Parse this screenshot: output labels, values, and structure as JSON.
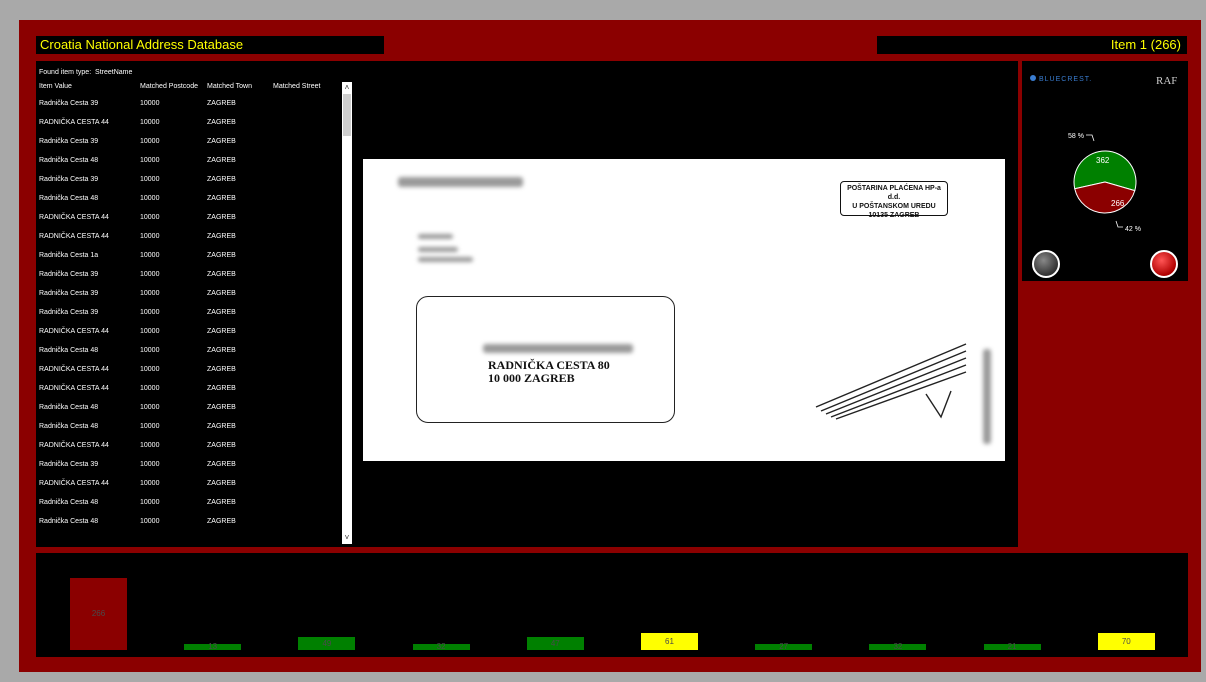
{
  "header": {
    "title": "Croatia National Address Database",
    "item_counter": "Item 1 (266)"
  },
  "list": {
    "found_label": "Found item type:",
    "found_value": "StreetName",
    "columns": [
      "Item Value",
      "Matched Postcode",
      "Matched Town",
      "Matched Street"
    ],
    "rows": [
      [
        "Radnička Cesta 39",
        "10000",
        "ZAGREB",
        ""
      ],
      [
        "RADNIČKA CESTA 44",
        "10000",
        "ZAGREB",
        ""
      ],
      [
        "Radnička Cesta 39",
        "10000",
        "ZAGREB",
        ""
      ],
      [
        "Radnička Cesta 48",
        "10000",
        "ZAGREB",
        ""
      ],
      [
        "Radnička Cesta 39",
        "10000",
        "ZAGREB",
        ""
      ],
      [
        "Radnička Cesta 48",
        "10000",
        "ZAGREB",
        ""
      ],
      [
        "RADNIČKA CESTA 44",
        "10000",
        "ZAGREB",
        ""
      ],
      [
        "RADNIČKA CESTA 44",
        "10000",
        "ZAGREB",
        ""
      ],
      [
        "Radnička Cesta 1a",
        "10000",
        "ZAGREB",
        ""
      ],
      [
        "Radnička Cesta 39",
        "10000",
        "ZAGREB",
        ""
      ],
      [
        "Radnička Cesta 39",
        "10000",
        "ZAGREB",
        ""
      ],
      [
        "Radnička Cesta 39",
        "10000",
        "ZAGREB",
        ""
      ],
      [
        "RADNIČKA CESTA 44",
        "10000",
        "ZAGREB",
        ""
      ],
      [
        "Radnička Cesta 48",
        "10000",
        "ZAGREB",
        ""
      ],
      [
        "RADNIČKA CESTA 44",
        "10000",
        "ZAGREB",
        ""
      ],
      [
        "RADNIČKA CESTA 44",
        "10000",
        "ZAGREB",
        ""
      ],
      [
        "Radnička Cesta 48",
        "10000",
        "ZAGREB",
        ""
      ],
      [
        "Radnička Cesta 48",
        "10000",
        "ZAGREB",
        ""
      ],
      [
        "RADNIČKA CESTA 44",
        "10000",
        "ZAGREB",
        ""
      ],
      [
        "Radnička Cesta 39",
        "10000",
        "ZAGREB",
        ""
      ],
      [
        "RADNIČKA CESTA 44",
        "10000",
        "ZAGREB",
        ""
      ],
      [
        "Radnička Cesta 48",
        "10000",
        "ZAGREB",
        ""
      ],
      [
        "Radnička Cesta 48",
        "10000",
        "ZAGREB",
        ""
      ]
    ]
  },
  "envelope": {
    "stamp_lines": [
      "POŠTARINA PLAĆENA HP-a d.d.",
      "U POŠTANSKOM UREDU",
      "10135 ZAGREB"
    ],
    "address_line1": "RADNIČKA CESTA 80",
    "address_line2": "10 000 ZAGREB"
  },
  "logos": {
    "bluecrest": "BLUECREST.",
    "raf": "RAF"
  },
  "pie": {
    "green_value": "362",
    "red_value": "266",
    "green_pct_label": "58 %",
    "red_pct_label": "42 %",
    "green_pct": 58,
    "red_pct": 42,
    "colors": {
      "green": "#008000",
      "red": "#8b0000"
    }
  },
  "bars": {
    "colors": {
      "red": "#8b0000",
      "green": "#008000",
      "yellow": "#ffff00"
    },
    "items": [
      {
        "label": "266",
        "value": 266,
        "color": "red"
      },
      {
        "label": "13",
        "value": 13,
        "color": "green"
      },
      {
        "label": "49",
        "value": 49,
        "color": "green"
      },
      {
        "label": "32",
        "value": 32,
        "color": "green"
      },
      {
        "label": "47",
        "value": 47,
        "color": "green"
      },
      {
        "label": "61",
        "value": 61,
        "color": "yellow"
      },
      {
        "label": "27",
        "value": 27,
        "color": "green"
      },
      {
        "label": "32",
        "value": 32,
        "color": "green"
      },
      {
        "label": "21",
        "value": 21,
        "color": "green"
      },
      {
        "label": "70",
        "value": 70,
        "color": "yellow"
      }
    ]
  },
  "status_icons": [
    "gray-circle-icon",
    "red-circle-icon"
  ]
}
